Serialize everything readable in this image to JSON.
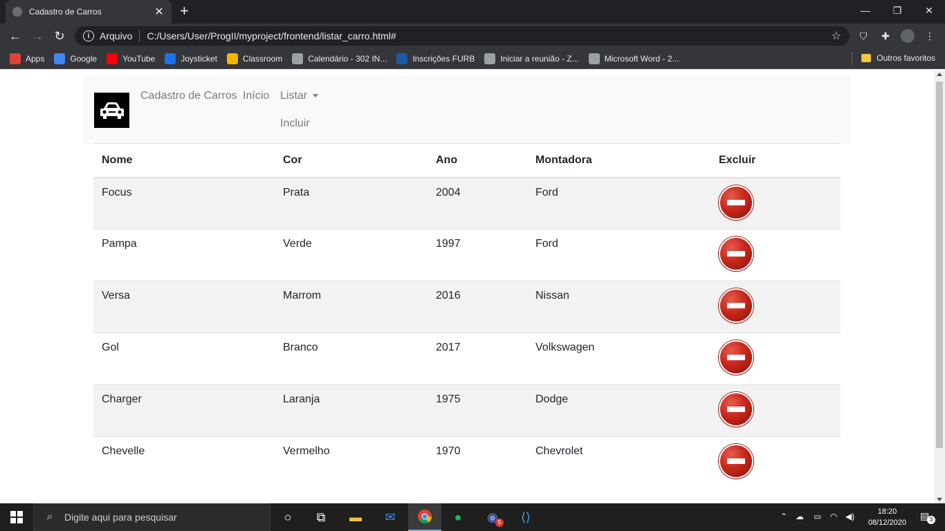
{
  "browser": {
    "tab_title": "Cadastro de Carros",
    "tab_close": "✕",
    "new_tab": "+",
    "url_prefix": "Arquivo",
    "url": "C:/Users/User/ProgII/myproject/frontend/listar_carro.html#",
    "bookmarks": [
      {
        "label": "Apps",
        "icon": "apps-grid-icon",
        "color": "#e34133"
      },
      {
        "label": "Google",
        "icon": "google-icon",
        "color": "#4285f4"
      },
      {
        "label": "YouTube",
        "icon": "youtube-icon",
        "color": "#ff0000"
      },
      {
        "label": "Joysticket",
        "icon": "joysticket-icon",
        "color": "#1a73e8"
      },
      {
        "label": "Classroom",
        "icon": "classroom-icon",
        "color": "#f4b400"
      },
      {
        "label": "Calendário - 302 IN...",
        "icon": "globe-icon",
        "color": "#9aa0a6"
      },
      {
        "label": "Inscrições FURB",
        "icon": "furb-icon",
        "color": "#1c5aa6"
      },
      {
        "label": "Iniciar a reunião - Z...",
        "icon": "globe-icon",
        "color": "#9aa0a6"
      },
      {
        "label": "Microsoft Word - 2...",
        "icon": "globe-icon",
        "color": "#9aa0a6"
      }
    ],
    "other_bookmarks": "Outros favoritos"
  },
  "navbar": {
    "brand": "Cadastro de Carros",
    "inicio": "Início",
    "listar": "Listar",
    "incluir": "Incluir"
  },
  "table": {
    "headers": [
      "Nome",
      "Cor",
      "Ano",
      "Montadora",
      "Excluir"
    ],
    "rows": [
      {
        "nome": "Focus",
        "cor": "Prata",
        "ano": "2004",
        "montadora": "Ford"
      },
      {
        "nome": "Pampa",
        "cor": "Verde",
        "ano": "1997",
        "montadora": "Ford"
      },
      {
        "nome": "Versa",
        "cor": "Marrom",
        "ano": "2016",
        "montadora": "Nissan"
      },
      {
        "nome": "Gol",
        "cor": "Branco",
        "ano": "2017",
        "montadora": "Volkswagen"
      },
      {
        "nome": "Charger",
        "cor": "Laranja",
        "ano": "1975",
        "montadora": "Dodge"
      },
      {
        "nome": "Chevelle",
        "cor": "Vermelho",
        "ano": "1970",
        "montadora": "Chevrolet"
      }
    ]
  },
  "taskbar": {
    "search_placeholder": "Digite aqui para pesquisar",
    "time": "18:20",
    "date": "08/12/2020",
    "notification_count": "3",
    "discord_badge": "5"
  },
  "colors": {
    "delete_button": "#c8281c",
    "navbar_bg": "#f8f9fa",
    "striped_row": "#f2f2f2"
  }
}
